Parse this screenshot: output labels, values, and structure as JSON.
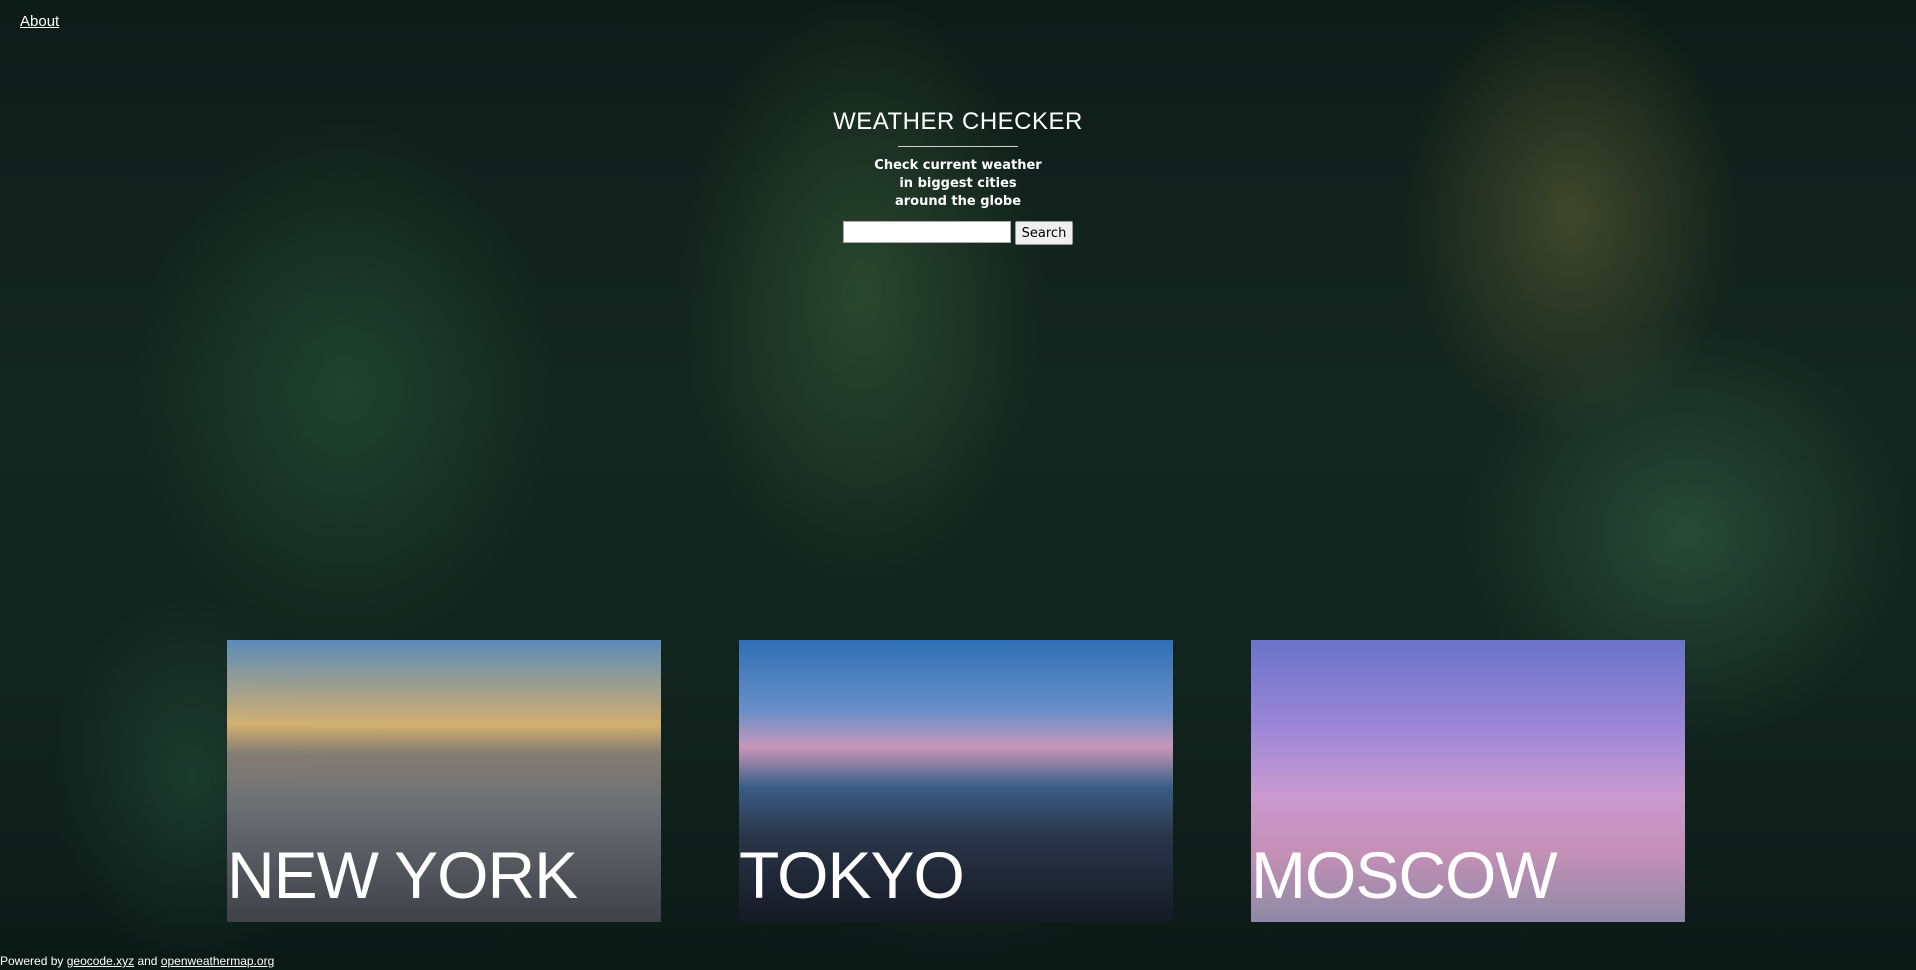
{
  "nav": {
    "about_label": "About"
  },
  "hero": {
    "title": "WEATHER CHECKER",
    "subtitle_lines": [
      "Check current weather",
      "in biggest cities",
      "around the globe"
    ],
    "search_value": "",
    "search_button_label": "Search"
  },
  "cities": [
    {
      "label": "NEW YORK"
    },
    {
      "label": "TOKYO"
    },
    {
      "label": "MOSCOW"
    }
  ],
  "footer": {
    "prefix": "Powered by",
    "link1": "geocode.xyz",
    "conjunction": "and",
    "link2": "openweathermap.org"
  }
}
